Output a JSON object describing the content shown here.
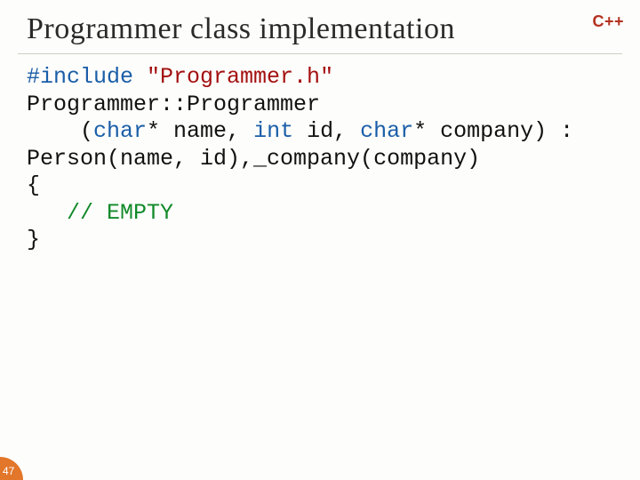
{
  "title": "Programmer class implementation",
  "badge": "C++",
  "slide_number": "47",
  "code": {
    "l1a": "#include ",
    "l1b": "\"Programmer.h\"",
    "l2": "Programmer::Programmer",
    "l3a": "    (",
    "l3b": "char",
    "l3c": "* name, ",
    "l3d": "int",
    "l3e": " id, ",
    "l3f": "char",
    "l3g": "* company) :",
    "l4": "Person(name, id),_company(company)",
    "l5": "{",
    "l6a": "   ",
    "l6b": "// EMPTY",
    "l7": "}"
  }
}
